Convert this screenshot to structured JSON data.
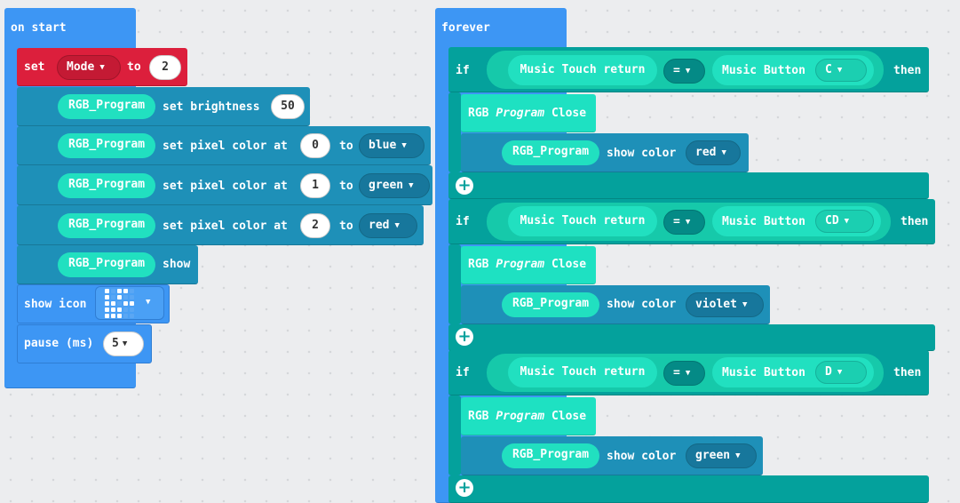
{
  "on_start": {
    "header": "on start",
    "set_block": {
      "set_label": "set",
      "variable": "Mode",
      "to_label": "to",
      "value": "2"
    },
    "brightness": {
      "target": "RGB_Program",
      "action": "set brightness",
      "value": "50"
    },
    "pixels": [
      {
        "target": "RGB_Program",
        "action": "set pixel color at",
        "index": "0",
        "to_label": "to",
        "color": "blue"
      },
      {
        "target": "RGB_Program",
        "action": "set pixel color at",
        "index": "1",
        "to_label": "to",
        "color": "green"
      },
      {
        "target": "RGB_Program",
        "action": "set pixel color at",
        "index": "2",
        "to_label": "to",
        "color": "red"
      }
    ],
    "show": {
      "target": "RGB_Program",
      "action": "show"
    },
    "show_icon": {
      "label": "show icon"
    },
    "pause": {
      "label": "pause (ms)",
      "value": "5"
    }
  },
  "forever": {
    "header": "forever",
    "if_blocks": [
      {
        "if_label": "if",
        "left": "Music Touch return",
        "op": "=",
        "right_label": "Music Button",
        "right_value": "C",
        "then_label": "then",
        "close_label_a": "RGB",
        "close_label_b": "Program",
        "close_label_c": "Close",
        "show_target": "RGB_Program",
        "show_action": "show color",
        "show_color": "red"
      },
      {
        "if_label": "if",
        "left": "Music Touch return",
        "op": "=",
        "right_label": "Music Button",
        "right_value": "CD",
        "then_label": "then",
        "close_label_a": "RGB",
        "close_label_b": "Program",
        "close_label_c": "Close",
        "show_target": "RGB_Program",
        "show_action": "show color",
        "show_color": "violet"
      },
      {
        "if_label": "if",
        "left": "Music Touch return",
        "op": "=",
        "right_label": "Music Button",
        "right_value": "D",
        "then_label": "then",
        "close_label_a": "RGB",
        "close_label_b": "Program",
        "close_label_c": "Close",
        "show_target": "RGB_Program",
        "show_action": "show color",
        "show_color": "green"
      }
    ]
  },
  "icons": {
    "caret": "▼",
    "plus": "+"
  },
  "colors": {
    "blue": "#3d96f4",
    "red": "#dc1f3c",
    "dark_teal": "#1e90b8",
    "teal": "#04a19c",
    "mint": "#1ee1c2"
  }
}
